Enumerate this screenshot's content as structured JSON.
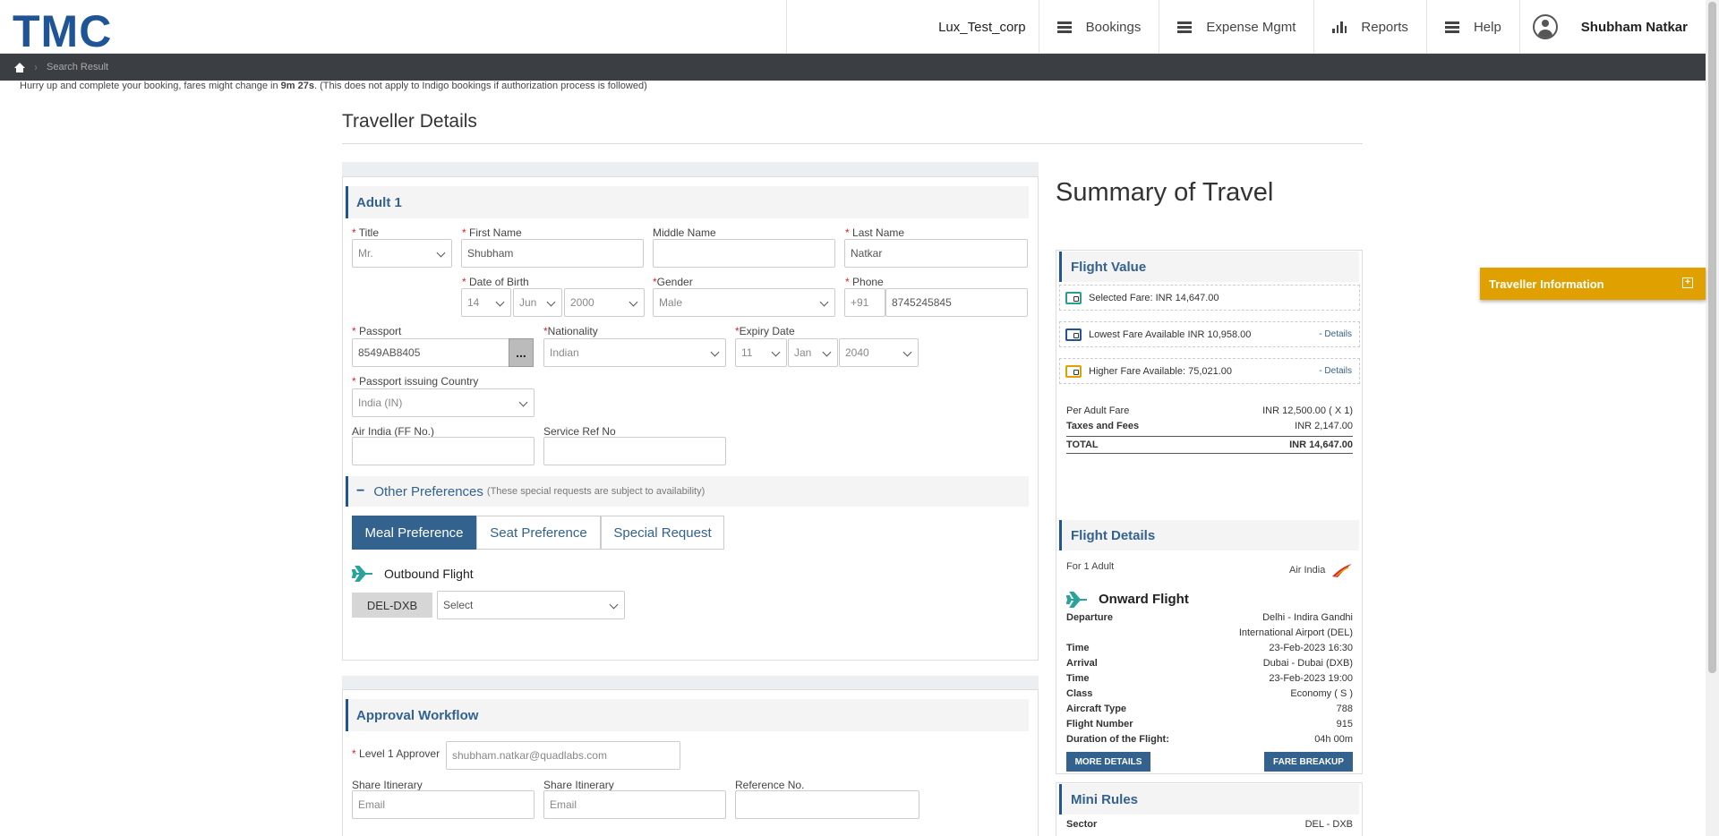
{
  "header": {
    "logo": "TMC",
    "corp": "Lux_Test_corp",
    "nav": [
      {
        "label": "Bookings",
        "icon": "menu-icon"
      },
      {
        "label": "Expense Mgmt",
        "icon": "menu-icon"
      },
      {
        "label": "Reports",
        "icon": "bar-chart-icon"
      },
      {
        "label": "Help",
        "icon": "menu-icon"
      }
    ],
    "user": "Shubham Natkar"
  },
  "breadcrumb": {
    "current": "Search Result"
  },
  "timer": {
    "prefix": "Hurry up and complete your booking, fares might change in ",
    "time": "9m 27s",
    "suffix": ". (This does not apply to Indigo bookings if authorization process is followed)"
  },
  "page": {
    "title": "Traveller Details"
  },
  "traveller": {
    "heading": "Adult 1",
    "labels": {
      "title": "Title",
      "first_name": "First Name",
      "middle_name": "Middle Name",
      "last_name": "Last Name",
      "dob": "Date of Birth",
      "gender": "Gender",
      "phone": "Phone",
      "passport": "Passport",
      "nationality": "Nationality",
      "expiry": "Expiry Date",
      "issuing_country": "Passport issuing Country",
      "ff": "Air India (FF No.)",
      "service_ref": "Service Ref No"
    },
    "values": {
      "title": "Mr.",
      "first_name": "Shubham",
      "middle_name": "",
      "last_name": "Natkar",
      "dob_day": "14",
      "dob_month": "Jun",
      "dob_year": "2000",
      "gender": "Male",
      "phone_code": "+91",
      "phone": "8745245845",
      "passport": "8549AB8405",
      "passport_btn": "...",
      "nationality": "Indian",
      "exp_day": "11",
      "exp_month": "Jan",
      "exp_year": "2040",
      "issuing_country": "India (IN)",
      "ff": "",
      "service_ref": ""
    }
  },
  "preferences": {
    "title": "Other Preferences",
    "note": "(These special requests are subject to availability)",
    "tabs": [
      "Meal Preference",
      "Seat Preference",
      "Special Request"
    ],
    "flight_label": "Outbound Flight",
    "sector": "DEL-DXB",
    "meal_select": "Select"
  },
  "approval": {
    "heading": "Approval Workflow",
    "approver_label": "Level 1 Approver",
    "approver_value": "shubham.natkar@quadlabs.com",
    "share1_label": "Share Itinerary",
    "share1_placeholder": "Email",
    "share2_label": "Share Itinerary",
    "share2_placeholder": "Email",
    "ref_label": "Reference No.",
    "ref_value": ""
  },
  "summary": {
    "title": "Summary of Travel",
    "flight_value": {
      "heading": "Flight Value",
      "selected": "Selected Fare: INR 14,647.00",
      "lowest": "Lowest Fare Available INR 10,958.00",
      "lowest_link": "- Details",
      "higher": "Higher Fare Available: 75,021.00",
      "higher_link": "- Details",
      "per_adult_k": "Per Adult Fare",
      "per_adult_v": "INR 12,500.00 ( X 1)",
      "taxes_k": "Taxes and Fees",
      "taxes_v": "INR 2,147.00",
      "total_k": "TOTAL",
      "total_v": "INR 14,647.00"
    },
    "flight_details": {
      "heading": "Flight Details",
      "for": "For 1 Adult",
      "airline": "Air India",
      "onward": "Onward Flight",
      "departure_k": "Departure",
      "departure_v1": "Delhi - Indira Gandhi",
      "departure_v2": "International Airport (DEL)",
      "time1_k": "Time",
      "time1_v": "23-Feb-2023 16:30",
      "arrival_k": "Arrival",
      "arrival_v": "Dubai - Dubai (DXB)",
      "time2_k": "Time",
      "time2_v": "23-Feb-2023 19:00",
      "class_k": "Class",
      "class_v": "Economy ( S )",
      "aircraft_k": "Aircraft Type",
      "aircraft_v": "788",
      "flightno_k": "Flight Number",
      "flightno_v": "915",
      "duration_k": "Duration of the Flight:",
      "duration_v": "04h 00m",
      "more_btn": "MORE DETAILS",
      "fare_btn": "FARE BREAKUP"
    },
    "mini_rules": {
      "heading": "Mini Rules",
      "sector_k": "Sector",
      "sector_v": "DEL - DXB"
    }
  },
  "traveller_info_tab": {
    "label": "Traveller Information",
    "icon": "expand-icon"
  },
  "colors": {
    "brand": "#1f5596",
    "accent": "#e0a100",
    "header_dark": "#3b3f44",
    "tab_active": "#33628f"
  }
}
